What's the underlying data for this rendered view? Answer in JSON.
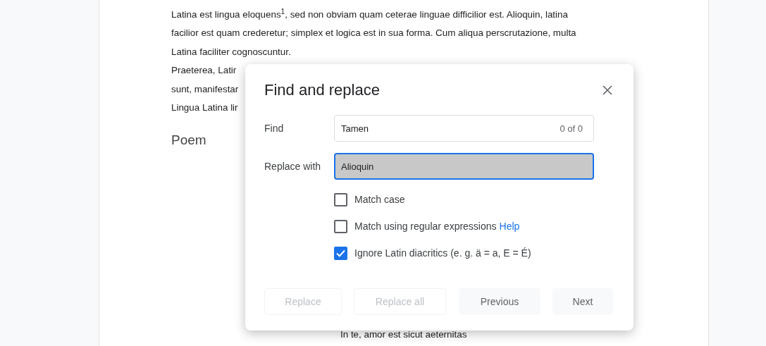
{
  "document": {
    "paragraph_lines": [
      "Latina est lingua eloquens$^{1}$, sed non obviam quam ceterae linguae difficilior est. Alioquin, latina",
      "facilior est quam crederetur; simplex et logica est in sua forma. Cum aliqua perscrutazione, multa",
      "Latina faciliter cognoscuntur.",
      "Praeterea, Latir",
      "sunt, manifestar",
      "Lingua Latina lir"
    ],
    "heading": "Poem",
    "poem_lines": [
      "In te, amor est sicut aeternitas"
    ]
  },
  "dialog": {
    "title": "Find and replace",
    "fields": [
      {
        "label": "Find",
        "value": "Tamen",
        "count": "0 of 0",
        "focused": false
      },
      {
        "label": "Replace with",
        "value": "Alioquin",
        "focused": true
      }
    ],
    "options": [
      {
        "label": "Match case",
        "checked": false
      },
      {
        "label": "Match using regular expressions",
        "link": "Help",
        "checked": false
      },
      {
        "label": "Ignore Latin diacritics (e. g. ä = a, E = É)",
        "checked": true
      }
    ],
    "buttons": [
      {
        "label": "Replace",
        "disabled": true
      },
      {
        "label": "Replace all",
        "disabled": true
      },
      {
        "label": "Previous",
        "disabled": false
      },
      {
        "label": "Next",
        "disabled": false
      }
    ]
  }
}
